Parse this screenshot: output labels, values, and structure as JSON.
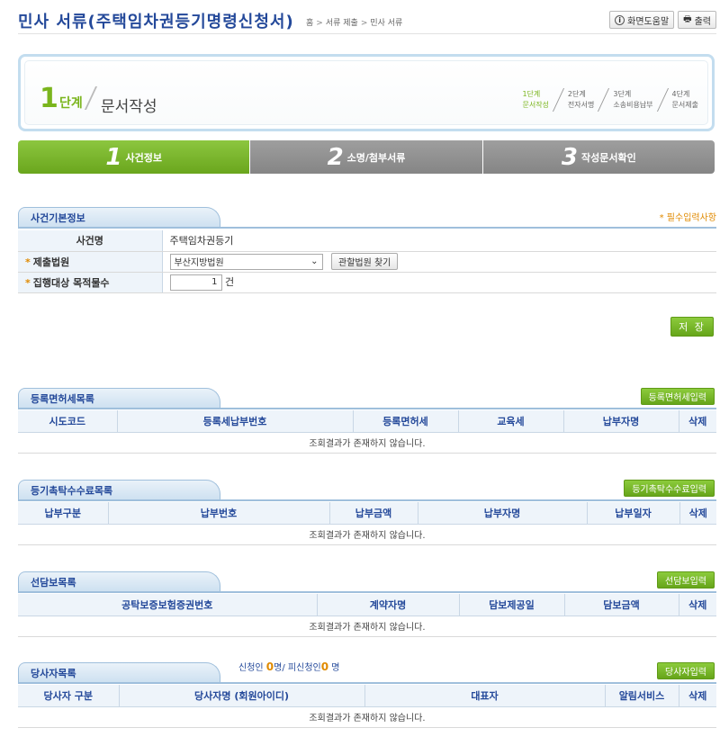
{
  "header": {
    "title": "민사 서류(주택임차권등기명령신청서)",
    "breadcrumb": [
      "홈",
      "서류 제출",
      "민사 서류"
    ],
    "help_label": "화면도움말",
    "print_label": "출력"
  },
  "step": {
    "number": "1",
    "unit": "단계",
    "name": "문서작성",
    "mini_steps": [
      {
        "line1": "1단계",
        "line2": "문서작성",
        "active": true
      },
      {
        "line1": "2단계",
        "line2": "전자서명",
        "active": false
      },
      {
        "line1": "3단계",
        "line2": "소송비용납부",
        "active": false
      },
      {
        "line1": "4단계",
        "line2": "문서제출",
        "active": false
      }
    ]
  },
  "tabs": [
    {
      "num": "1",
      "label": "사건정보"
    },
    {
      "num": "2",
      "label": "소명/첨부서류"
    },
    {
      "num": "3",
      "label": "작성문서확인"
    }
  ],
  "case_info": {
    "title": "사건기본정보",
    "required_note": "* 필수입력사항",
    "rows": {
      "case_name_label": "사건명",
      "case_name_value": "주택임차권등기",
      "court_label": "제출법원",
      "court_value": "부산지방법원",
      "court_find_label": "관할법원 찾기",
      "target_label": "집행대상 목적물수",
      "target_value": "1",
      "target_unit": "건"
    },
    "save_label": "저 장"
  },
  "registration_tax": {
    "title": "등록면허세목록",
    "button": "등록면허세입력",
    "columns": [
      "시도코드",
      "등록세납부번호",
      "등록면허세",
      "교육세",
      "납부자명",
      "삭제"
    ],
    "empty": "조회결과가 존재하지 않습니다."
  },
  "registry_fee": {
    "title": "등기촉탁수수료목록",
    "button": "등기촉탁수수료입력",
    "columns": [
      "납부구분",
      "납부번호",
      "납부금액",
      "납부자명",
      "납부일자",
      "삭제"
    ],
    "empty": "조회결과가 존재하지 않습니다."
  },
  "collateral": {
    "title": "선담보목록",
    "button": "선담보입력",
    "columns": [
      "공탁보증보험증권번호",
      "계약자명",
      "담보제공일",
      "담보금액",
      "삭제"
    ],
    "empty": "조회결과가 존재하지 않습니다."
  },
  "parties": {
    "title": "당사자목록",
    "button": "당사자입력",
    "applicant_label": "신청인",
    "applicant_count": "0",
    "respondent_label": "피신청인",
    "respondent_count": "0",
    "unit": "명",
    "columns": [
      "당사자 구분",
      "당사자명 (회원아이디)",
      "대표자",
      "알림서비스",
      "삭제"
    ],
    "empty": "조회결과가 존재하지 않습니다."
  },
  "colors": {
    "accent_green": "#7ab51d",
    "title_blue": "#24499a",
    "required_orange": "#e08a00"
  }
}
